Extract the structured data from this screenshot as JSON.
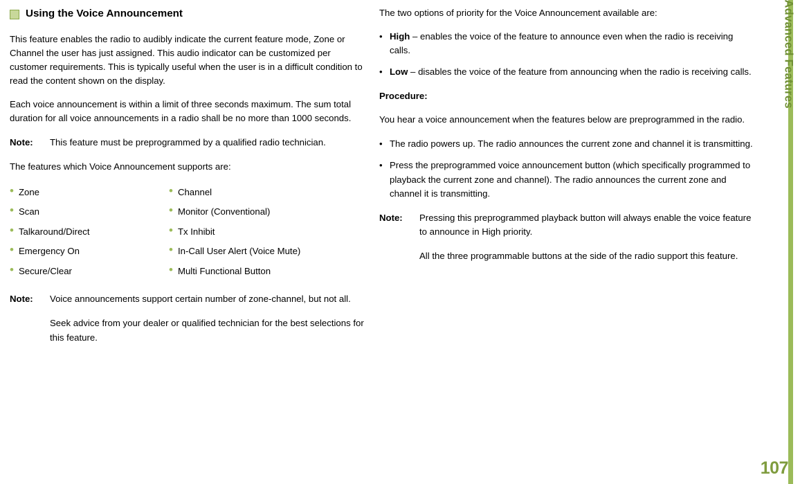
{
  "page": {
    "number": "107",
    "sidebar_label": "Advanced Features"
  },
  "left": {
    "title": "Using the Voice Announcement",
    "paragraphs": [
      "This feature enables the radio to audibly indicate the current feature mode, Zone or Channel the user has just assigned. This audio indicator can be customized per customer requirements. This is typically useful when the user is in a difficult condition to read the content shown on the display.",
      "Each voice announcement is within a limit of three seconds maximum. The sum total duration for all voice announcements in a radio shall be no more than 1000 seconds."
    ],
    "note1": {
      "label": "Note:",
      "text": "This feature must be preprogrammed by a qualified radio technician."
    },
    "supports_intro": "The features which Voice Announcement supports are:",
    "features": [
      {
        "left": "Zone",
        "right": "Channel"
      },
      {
        "left": "Scan",
        "right": "Monitor (Conventional)"
      },
      {
        "left": "Talkaround/Direct",
        "right": "Tx Inhibit"
      },
      {
        "left": "Emergency On",
        "right": "In-Call User Alert (Voice Mute)"
      },
      {
        "left": "Secure/Clear",
        "right": "Multi Functional Button"
      }
    ],
    "note2": {
      "label": "Note:",
      "text1": "Voice announcements support certain number of zone-channel, but not all.",
      "text2": "Seek advice from your dealer or qualified technician for the best selections for this feature."
    }
  },
  "right": {
    "intro": "The two options of priority for the Voice Announcement available are:",
    "options": [
      {
        "bullet": "•",
        "name": "High",
        "dash": "–",
        "desc": "enables the voice of the feature to announce even when the radio is receiving calls."
      },
      {
        "bullet": "•",
        "name": "Low",
        "dash": "–",
        "desc": "disables the voice of the feature from announcing when the radio is receiving calls."
      }
    ],
    "procedure_heading": "Procedure:",
    "procedure_intro": "You hear a voice announcement when the features below are preprogrammed in the radio.",
    "steps": [
      {
        "bullet": "•",
        "text": "The radio powers up. The radio announces the current zone and channel it is transmitting."
      },
      {
        "bullet": "•",
        "text": "Press the preprogrammed voice announcement button (which specifically programmed to playback the current zone and channel). The radio announces the current zone and channel it is transmitting."
      }
    ],
    "note": {
      "label": "Note:",
      "text1": "Pressing this preprogrammed playback button will always enable the voice feature to announce in High priority.",
      "text2": "All the three programmable buttons at the side of the radio support this feature."
    }
  },
  "colors": {
    "accent_green": "#9bbb59",
    "label_green": "#6f8f33",
    "page_number_green": "#7f9c3e"
  }
}
